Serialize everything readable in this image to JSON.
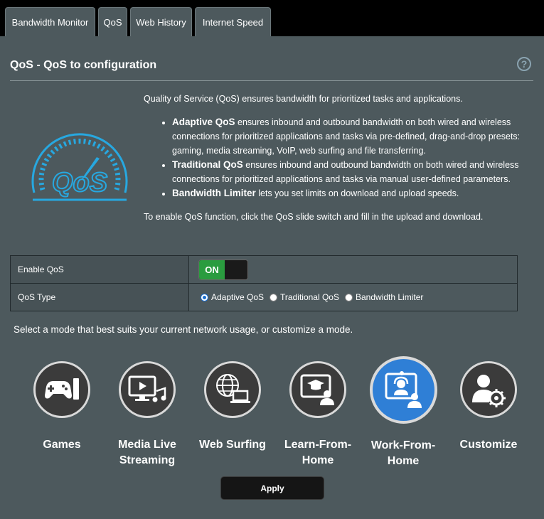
{
  "tabs": [
    {
      "label": "Bandwidth Monitor"
    },
    {
      "label": "QoS"
    },
    {
      "label": "Web History"
    },
    {
      "label": "Internet Speed"
    }
  ],
  "header": {
    "title": "QoS - QoS to configuration",
    "help": "?"
  },
  "logo_text": "QoS",
  "description": {
    "intro": "Quality of Service (QoS) ensures bandwidth for prioritized tasks and applications.",
    "bullets": [
      {
        "bold": "Adaptive QoS",
        "text": " ensures inbound and outbound bandwidth on both wired and wireless connections for prioritized applications and tasks via pre-defined, drag-and-drop presets: gaming, media streaming, VoIP, web surfing and file transferring."
      },
      {
        "bold": "Traditional QoS",
        "text": " ensures inbound and outbound bandwidth on both wired and wireless connections for prioritized applications and tasks via manual user-defined parameters."
      },
      {
        "bold": "Bandwidth Limiter",
        "text": " lets you set limits on download and upload speeds."
      }
    ],
    "enable_note": "To enable QoS function, click the QoS slide switch and fill in the upload and download."
  },
  "settings": {
    "enable_label": "Enable QoS",
    "toggle_state": "ON",
    "type_label": "QoS Type",
    "type_options": [
      "Adaptive QoS",
      "Traditional QoS",
      "Bandwidth Limiter"
    ],
    "type_selected": "Adaptive QoS"
  },
  "mode_prompt": "Select a mode that best suits your current network usage, or customize a mode.",
  "modes": [
    {
      "label1": "Games",
      "label2": "",
      "icon": "gamepad-icon"
    },
    {
      "label1": "Media Live",
      "label2": "Streaming",
      "icon": "media-streaming-icon"
    },
    {
      "label1": "Web Surfing",
      "label2": "",
      "icon": "web-surfing-icon"
    },
    {
      "label1": "Learn-From-",
      "label2": "Home",
      "icon": "learn-from-home-icon"
    },
    {
      "label1": "Work-From-",
      "label2": "Home",
      "icon": "work-from-home-icon"
    },
    {
      "label1": "Customize",
      "label2": "",
      "icon": "customize-icon"
    }
  ],
  "selected_mode": "Work-From-Home",
  "apply_label": "Apply",
  "colors": {
    "accent_blue": "#2f7fd6",
    "toggle_green": "#2a9c3f",
    "panel": "#4d595d",
    "logo_blue": "#27a8e0"
  }
}
